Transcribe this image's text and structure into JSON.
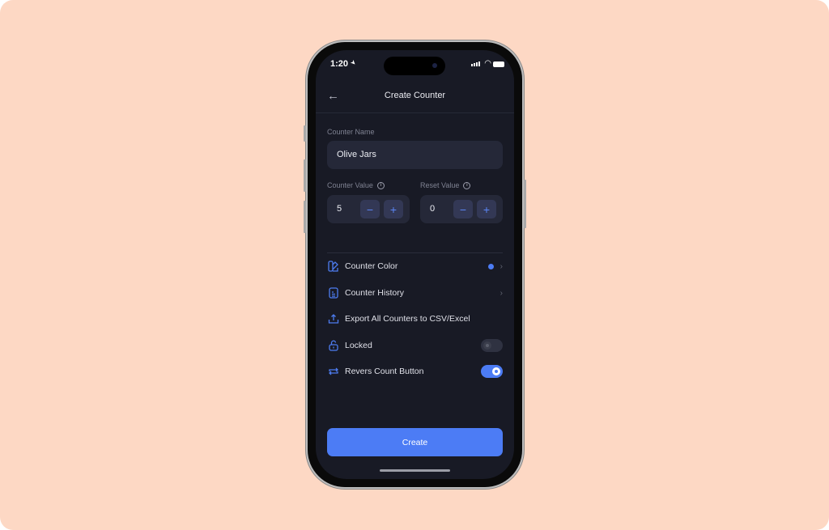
{
  "status": {
    "time": "1:20"
  },
  "header": {
    "title": "Create Counter",
    "back_icon": "arrow-left-icon"
  },
  "form": {
    "name_label": "Counter Name",
    "name_value": "Olive Jars",
    "counter_value_label": "Counter Value",
    "counter_value": "5",
    "reset_value_label": "Reset Value",
    "reset_value": "0",
    "minus": "−",
    "plus": "+",
    "info": "i"
  },
  "settings": [
    {
      "label": "Counter Color",
      "icon": "palette-icon",
      "color": "#4c7cf5"
    },
    {
      "label": "Counter History",
      "icon": "document-icon"
    },
    {
      "label": "Export All Counters to CSV/Excel",
      "icon": "upload-icon"
    },
    {
      "label": "Locked",
      "icon": "unlock-icon",
      "enabled": false
    },
    {
      "label": "Revers Count Button",
      "icon": "repeat-icon",
      "enabled": true
    }
  ],
  "chevron": "›",
  "create_label": "Create",
  "colors": {
    "accent": "#4c7cf5",
    "background": "#181a25",
    "surface": "#252838",
    "page": "#fdd8c4"
  }
}
